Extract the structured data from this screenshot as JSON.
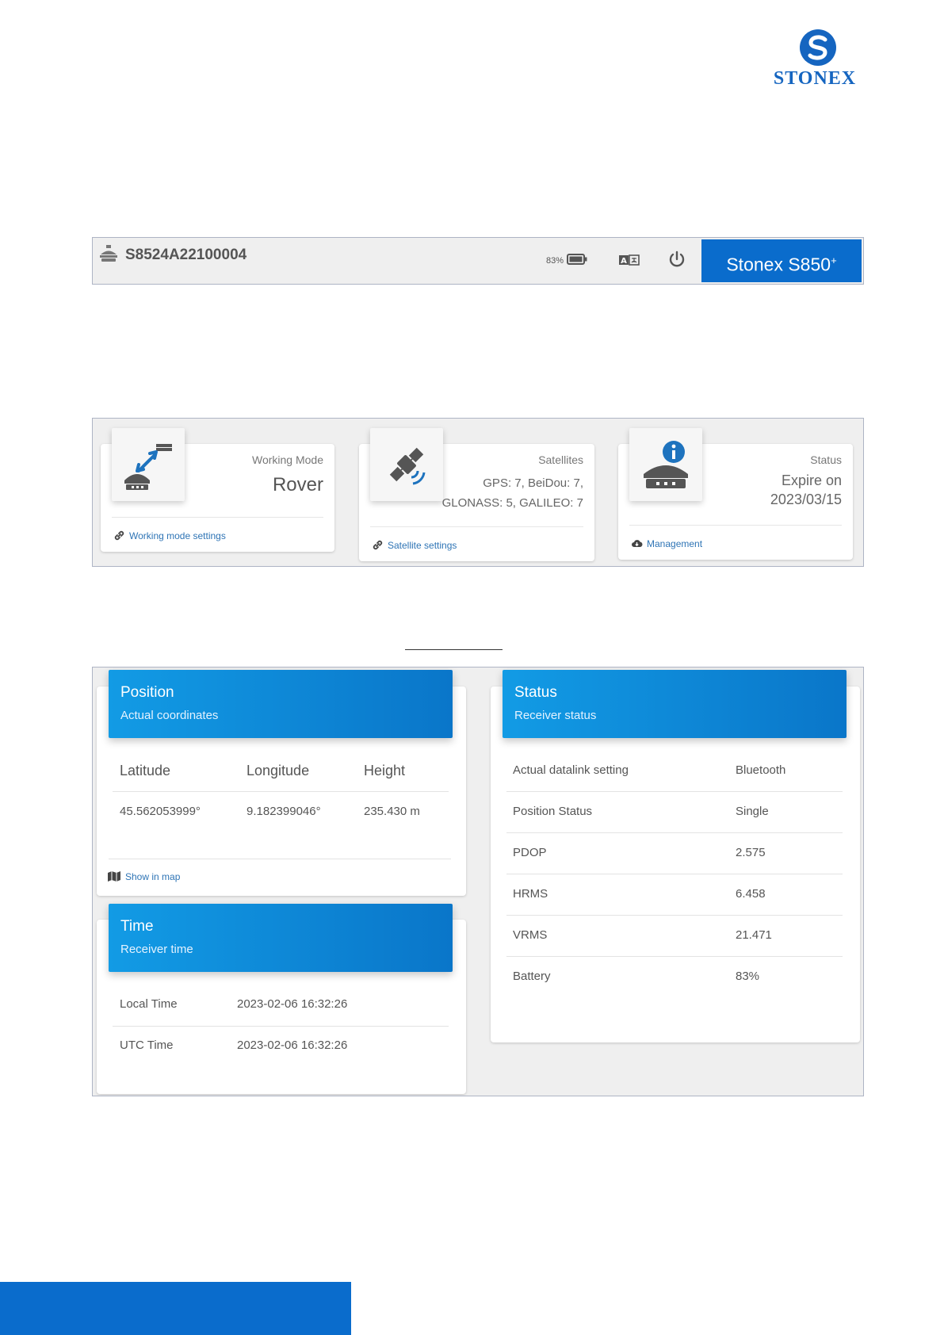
{
  "logo": {
    "text": "STONEX",
    "colors": {
      "brand": "#1565c0"
    }
  },
  "topbar": {
    "serial": "S8524A22100004",
    "battery_percent": "83%",
    "model_name": "Stonex S850",
    "model_suffix": "+",
    "icons": [
      "receiver-icon",
      "battery-icon",
      "language-icon",
      "power-icon"
    ],
    "accent_color": "#0a6ccc"
  },
  "cards": {
    "working_mode": {
      "caption": "Working Mode",
      "value": "Rover",
      "link": "Working mode settings"
    },
    "satellites": {
      "caption": "Satellites",
      "line1": "GPS: 7, BeiDou: 7,",
      "line2": "GLONASS: 5, GALILEO: 7",
      "link": "Satellite settings"
    },
    "status": {
      "caption": "Status",
      "line1": "Expire on",
      "line2": "2023/03/15",
      "link": "Management"
    }
  },
  "position": {
    "title": "Position",
    "subtitle": "Actual coordinates",
    "headers": [
      "Latitude",
      "Longitude",
      "Height"
    ],
    "values": [
      "45.562053999°",
      "9.182399046°",
      "235.430 m"
    ],
    "map_link": "Show in map"
  },
  "time": {
    "title": "Time",
    "subtitle": "Receiver time",
    "rows": [
      {
        "label": "Local Time",
        "value": "2023-02-06 16:32:26"
      },
      {
        "label": "UTC Time",
        "value": "2023-02-06 16:32:26"
      }
    ]
  },
  "status": {
    "title": "Status",
    "subtitle": "Receiver status",
    "rows": [
      {
        "label": "Actual datalink setting",
        "value": "Bluetooth"
      },
      {
        "label": "Position Status",
        "value": "Single"
      },
      {
        "label": "PDOP",
        "value": "2.575"
      },
      {
        "label": "HRMS",
        "value": "6.458"
      },
      {
        "label": "VRMS",
        "value": "21.471"
      },
      {
        "label": "Battery",
        "value": "83%"
      }
    ]
  }
}
